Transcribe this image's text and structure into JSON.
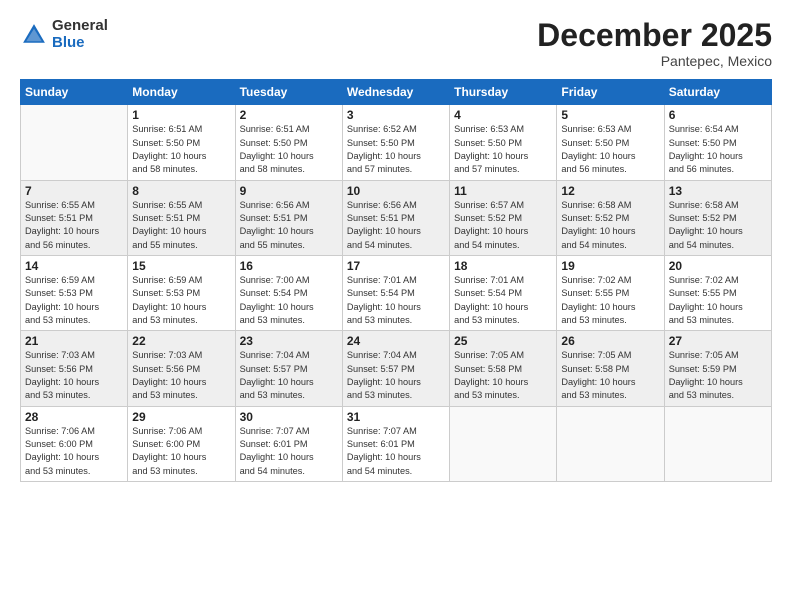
{
  "logo": {
    "general": "General",
    "blue": "Blue"
  },
  "title": "December 2025",
  "subtitle": "Pantepec, Mexico",
  "header_days": [
    "Sunday",
    "Monday",
    "Tuesday",
    "Wednesday",
    "Thursday",
    "Friday",
    "Saturday"
  ],
  "weeks": [
    [
      {
        "num": "",
        "info": ""
      },
      {
        "num": "1",
        "info": "Sunrise: 6:51 AM\nSunset: 5:50 PM\nDaylight: 10 hours\nand 58 minutes."
      },
      {
        "num": "2",
        "info": "Sunrise: 6:51 AM\nSunset: 5:50 PM\nDaylight: 10 hours\nand 58 minutes."
      },
      {
        "num": "3",
        "info": "Sunrise: 6:52 AM\nSunset: 5:50 PM\nDaylight: 10 hours\nand 57 minutes."
      },
      {
        "num": "4",
        "info": "Sunrise: 6:53 AM\nSunset: 5:50 PM\nDaylight: 10 hours\nand 57 minutes."
      },
      {
        "num": "5",
        "info": "Sunrise: 6:53 AM\nSunset: 5:50 PM\nDaylight: 10 hours\nand 56 minutes."
      },
      {
        "num": "6",
        "info": "Sunrise: 6:54 AM\nSunset: 5:50 PM\nDaylight: 10 hours\nand 56 minutes."
      }
    ],
    [
      {
        "num": "7",
        "info": "Sunrise: 6:55 AM\nSunset: 5:51 PM\nDaylight: 10 hours\nand 56 minutes."
      },
      {
        "num": "8",
        "info": "Sunrise: 6:55 AM\nSunset: 5:51 PM\nDaylight: 10 hours\nand 55 minutes."
      },
      {
        "num": "9",
        "info": "Sunrise: 6:56 AM\nSunset: 5:51 PM\nDaylight: 10 hours\nand 55 minutes."
      },
      {
        "num": "10",
        "info": "Sunrise: 6:56 AM\nSunset: 5:51 PM\nDaylight: 10 hours\nand 54 minutes."
      },
      {
        "num": "11",
        "info": "Sunrise: 6:57 AM\nSunset: 5:52 PM\nDaylight: 10 hours\nand 54 minutes."
      },
      {
        "num": "12",
        "info": "Sunrise: 6:58 AM\nSunset: 5:52 PM\nDaylight: 10 hours\nand 54 minutes."
      },
      {
        "num": "13",
        "info": "Sunrise: 6:58 AM\nSunset: 5:52 PM\nDaylight: 10 hours\nand 54 minutes."
      }
    ],
    [
      {
        "num": "14",
        "info": "Sunrise: 6:59 AM\nSunset: 5:53 PM\nDaylight: 10 hours\nand 53 minutes."
      },
      {
        "num": "15",
        "info": "Sunrise: 6:59 AM\nSunset: 5:53 PM\nDaylight: 10 hours\nand 53 minutes."
      },
      {
        "num": "16",
        "info": "Sunrise: 7:00 AM\nSunset: 5:54 PM\nDaylight: 10 hours\nand 53 minutes."
      },
      {
        "num": "17",
        "info": "Sunrise: 7:01 AM\nSunset: 5:54 PM\nDaylight: 10 hours\nand 53 minutes."
      },
      {
        "num": "18",
        "info": "Sunrise: 7:01 AM\nSunset: 5:54 PM\nDaylight: 10 hours\nand 53 minutes."
      },
      {
        "num": "19",
        "info": "Sunrise: 7:02 AM\nSunset: 5:55 PM\nDaylight: 10 hours\nand 53 minutes."
      },
      {
        "num": "20",
        "info": "Sunrise: 7:02 AM\nSunset: 5:55 PM\nDaylight: 10 hours\nand 53 minutes."
      }
    ],
    [
      {
        "num": "21",
        "info": "Sunrise: 7:03 AM\nSunset: 5:56 PM\nDaylight: 10 hours\nand 53 minutes."
      },
      {
        "num": "22",
        "info": "Sunrise: 7:03 AM\nSunset: 5:56 PM\nDaylight: 10 hours\nand 53 minutes."
      },
      {
        "num": "23",
        "info": "Sunrise: 7:04 AM\nSunset: 5:57 PM\nDaylight: 10 hours\nand 53 minutes."
      },
      {
        "num": "24",
        "info": "Sunrise: 7:04 AM\nSunset: 5:57 PM\nDaylight: 10 hours\nand 53 minutes."
      },
      {
        "num": "25",
        "info": "Sunrise: 7:05 AM\nSunset: 5:58 PM\nDaylight: 10 hours\nand 53 minutes."
      },
      {
        "num": "26",
        "info": "Sunrise: 7:05 AM\nSunset: 5:58 PM\nDaylight: 10 hours\nand 53 minutes."
      },
      {
        "num": "27",
        "info": "Sunrise: 7:05 AM\nSunset: 5:59 PM\nDaylight: 10 hours\nand 53 minutes."
      }
    ],
    [
      {
        "num": "28",
        "info": "Sunrise: 7:06 AM\nSunset: 6:00 PM\nDaylight: 10 hours\nand 53 minutes."
      },
      {
        "num": "29",
        "info": "Sunrise: 7:06 AM\nSunset: 6:00 PM\nDaylight: 10 hours\nand 53 minutes."
      },
      {
        "num": "30",
        "info": "Sunrise: 7:07 AM\nSunset: 6:01 PM\nDaylight: 10 hours\nand 54 minutes."
      },
      {
        "num": "31",
        "info": "Sunrise: 7:07 AM\nSunset: 6:01 PM\nDaylight: 10 hours\nand 54 minutes."
      },
      {
        "num": "",
        "info": ""
      },
      {
        "num": "",
        "info": ""
      },
      {
        "num": "",
        "info": ""
      }
    ]
  ]
}
